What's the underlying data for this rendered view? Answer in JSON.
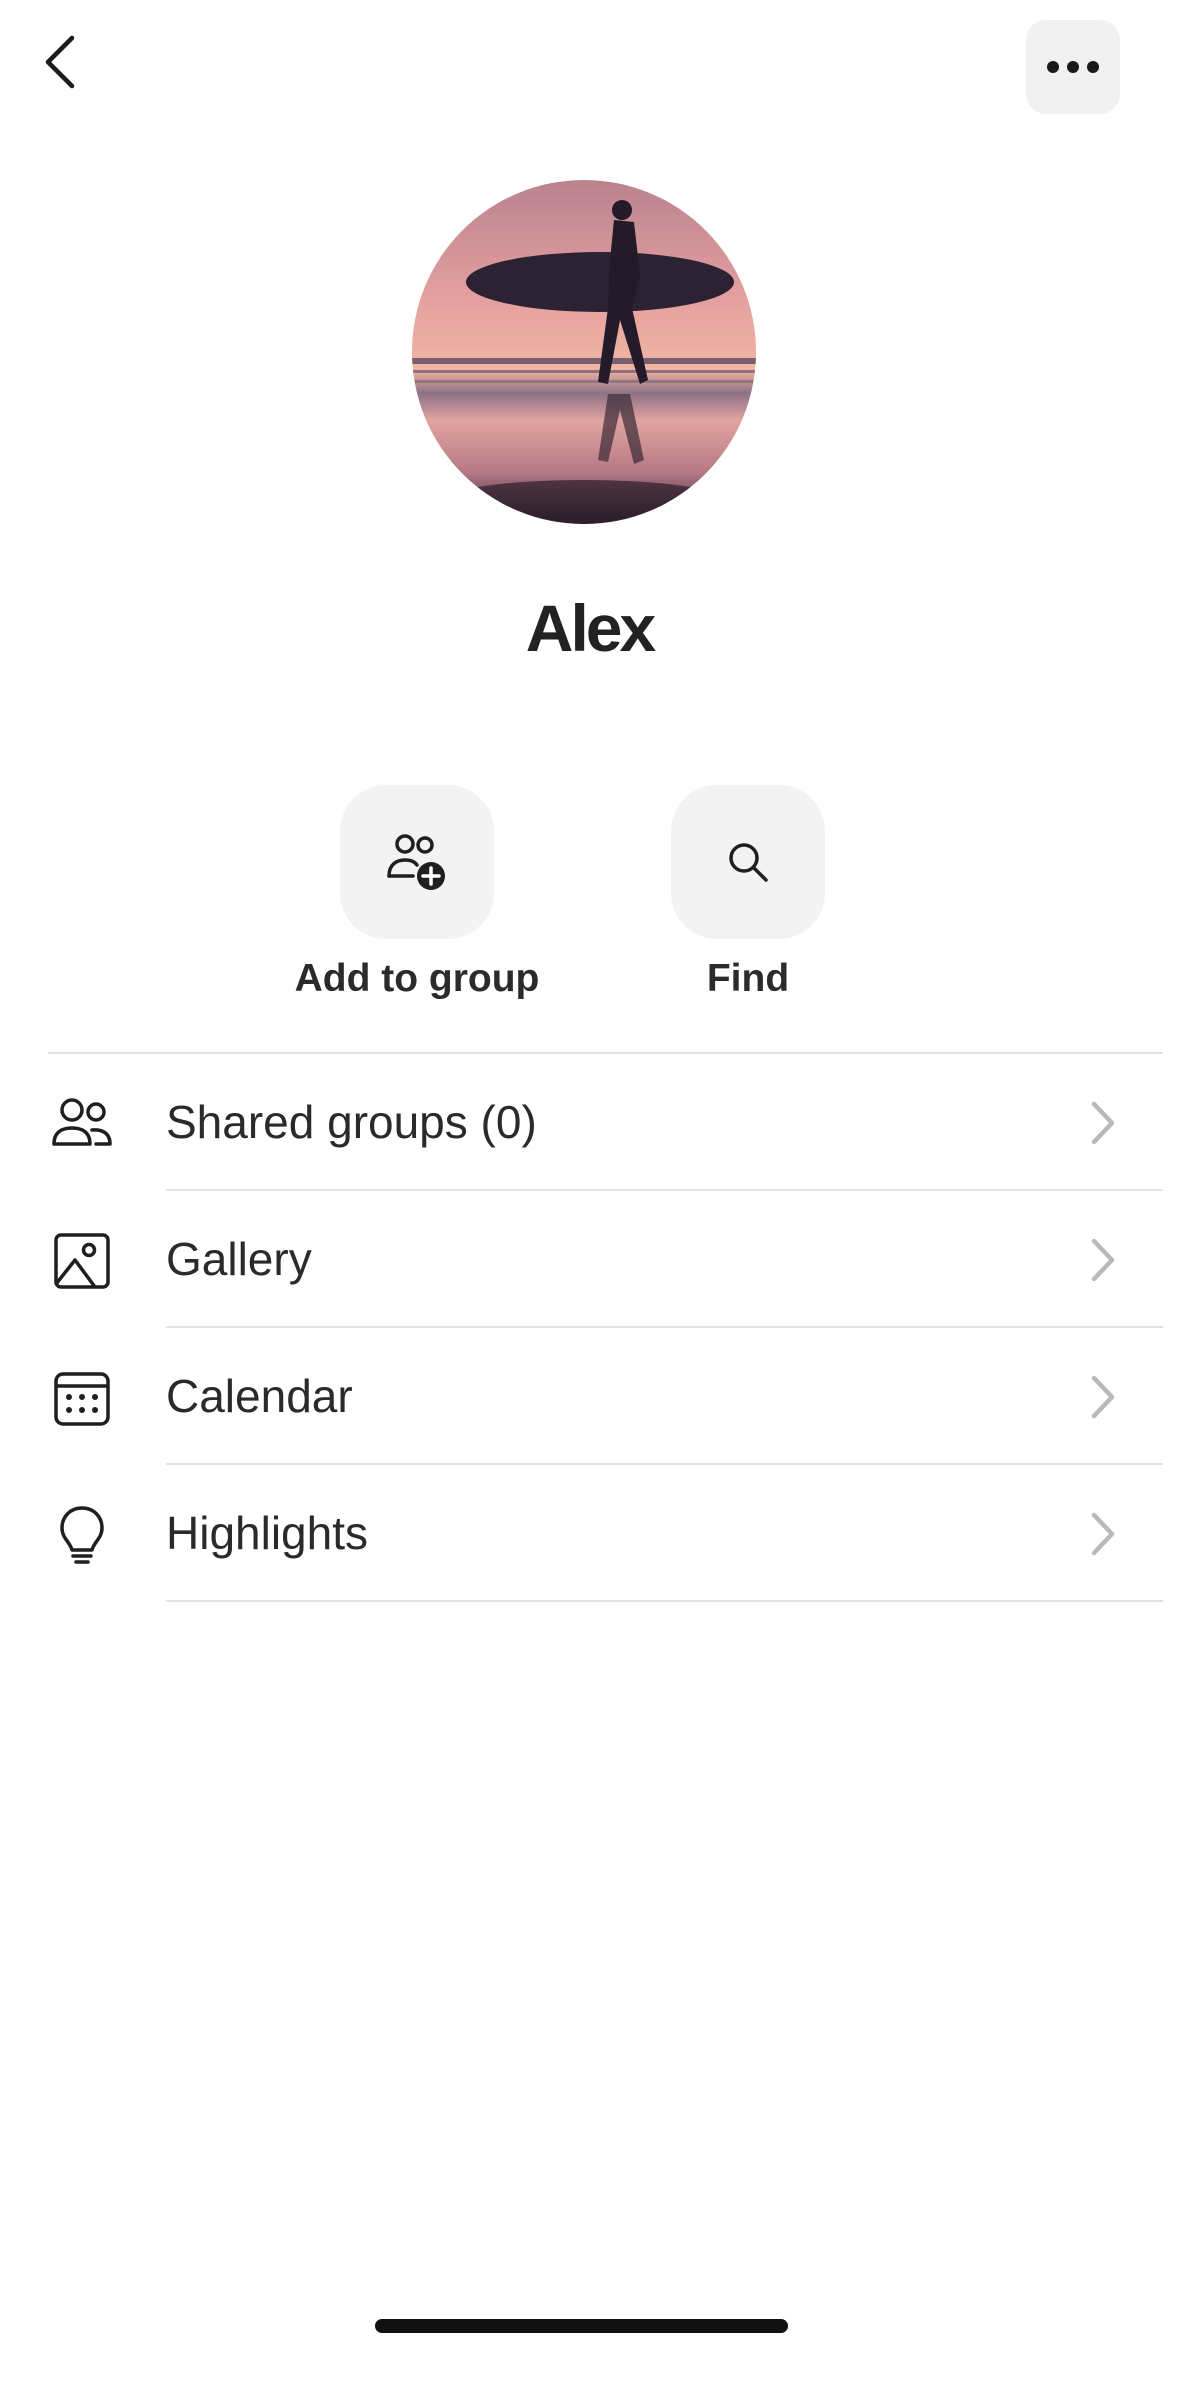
{
  "header": {
    "back_icon": "chevron-left-icon",
    "more_icon": "ellipsis-icon"
  },
  "profile": {
    "name": "Alex",
    "avatar": "surfer-silhouette-sunset-photo"
  },
  "actions": [
    {
      "label": "Add to group",
      "icon": "add-person-group-icon"
    },
    {
      "label": "Find",
      "icon": "search-icon"
    }
  ],
  "menu": [
    {
      "label": "Shared groups (0)",
      "icon": "people-icon"
    },
    {
      "label": "Gallery",
      "icon": "image-icon"
    },
    {
      "label": "Calendar",
      "icon": "calendar-icon"
    },
    {
      "label": "Highlights",
      "icon": "lightbulb-icon"
    }
  ],
  "colors": {
    "background": "#ffffff",
    "button_bg": "#f3f3f3",
    "divider": "#e2e2e2",
    "text": "#2a2a2a",
    "chevron": "#b9b9b9"
  }
}
